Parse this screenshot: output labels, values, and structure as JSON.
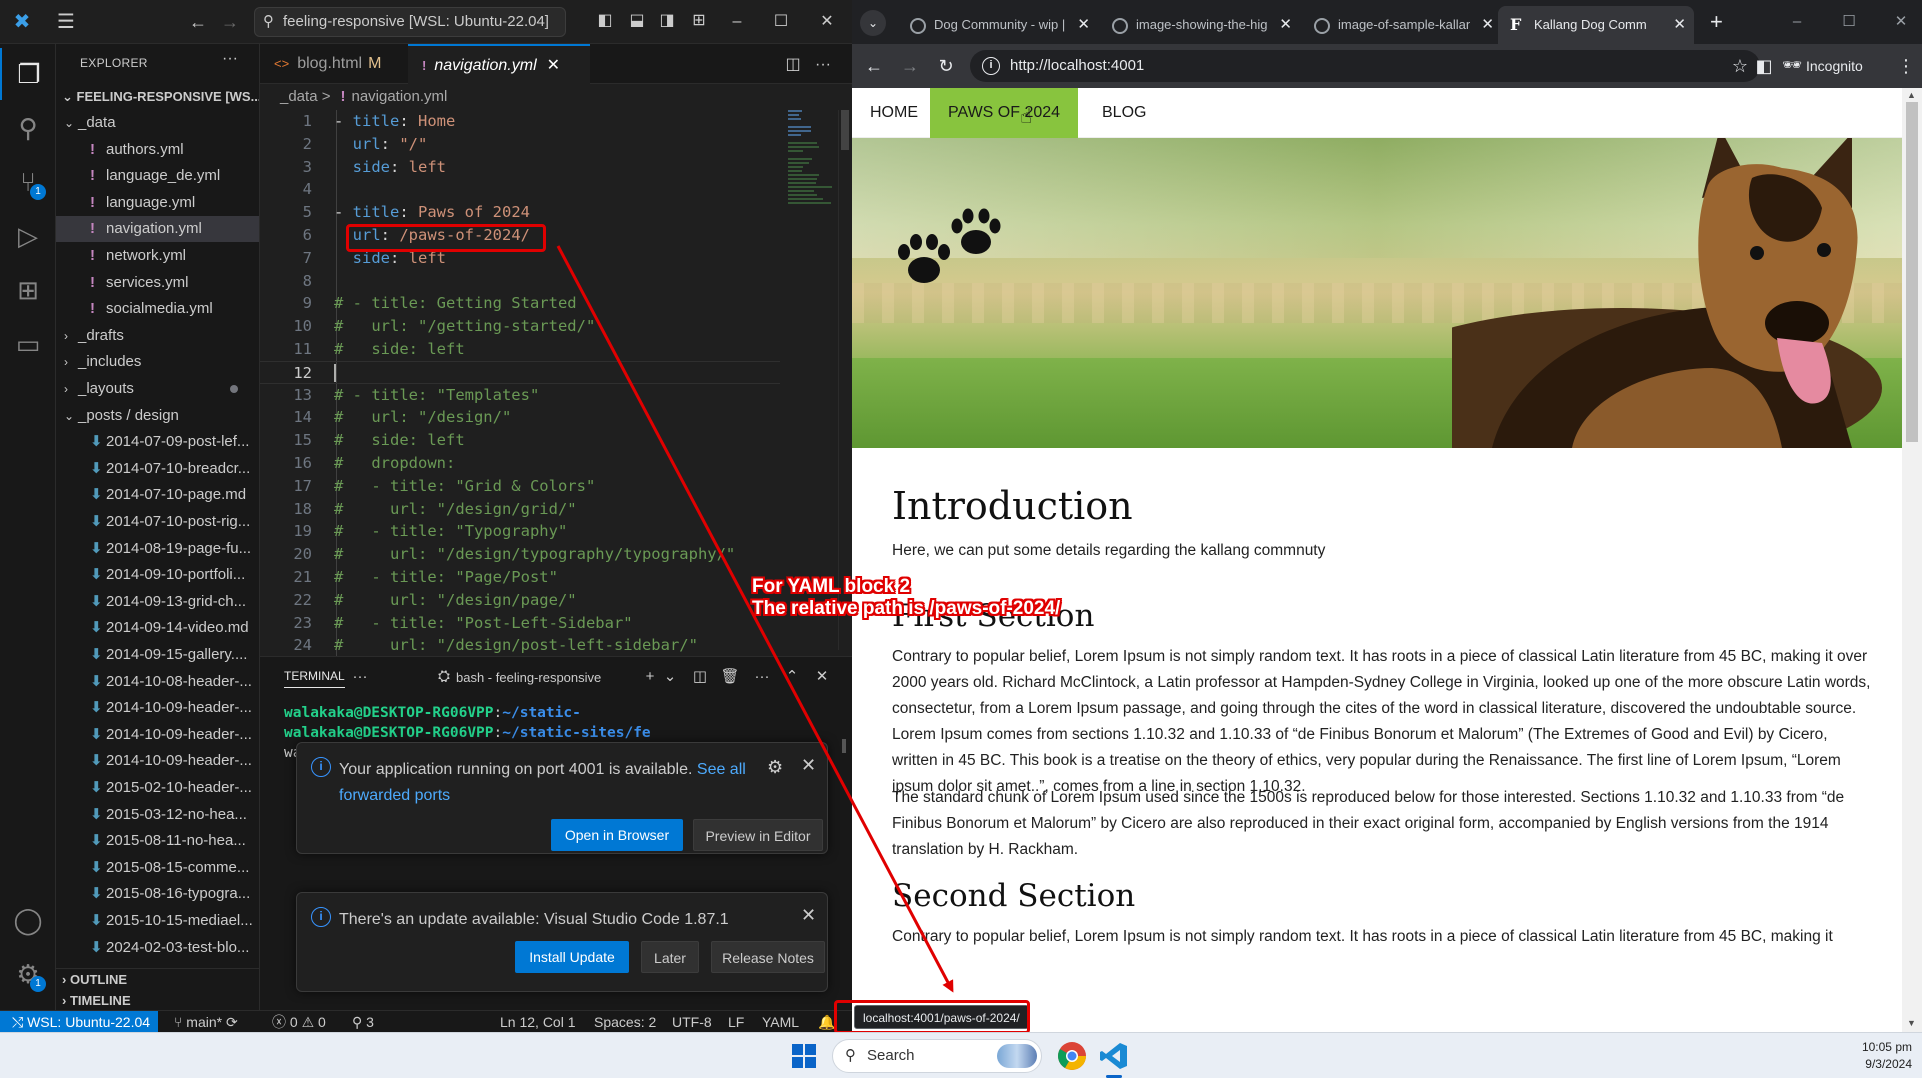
{
  "vscode": {
    "title": "feeling-responsive [WSL: Ubuntu-22.04]",
    "explorer": {
      "header": "EXPLORER",
      "root": "FEELING-RESPONSIVE [WS...",
      "items": [
        {
          "label": "_data",
          "kind": "folder-open",
          "indent": 1
        },
        {
          "label": "authors.yml",
          "kind": "yml",
          "indent": 2
        },
        {
          "label": "language_de.yml",
          "kind": "yml",
          "indent": 2
        },
        {
          "label": "language.yml",
          "kind": "yml",
          "indent": 2
        },
        {
          "label": "navigation.yml",
          "kind": "yml",
          "indent": 2,
          "selected": true
        },
        {
          "label": "network.yml",
          "kind": "yml",
          "indent": 2
        },
        {
          "label": "services.yml",
          "kind": "yml",
          "indent": 2
        },
        {
          "label": "socialmedia.yml",
          "kind": "yml",
          "indent": 2
        },
        {
          "label": "_drafts",
          "kind": "folder",
          "indent": 1
        },
        {
          "label": "_includes",
          "kind": "folder",
          "indent": 1
        },
        {
          "label": "_layouts",
          "kind": "folder",
          "indent": 1,
          "dot": true
        },
        {
          "label": "_posts / design",
          "kind": "folder-open",
          "indent": 1
        },
        {
          "label": "2014-07-09-post-lef...",
          "kind": "md",
          "indent": 2
        },
        {
          "label": "2014-07-10-breadcr...",
          "kind": "md",
          "indent": 2
        },
        {
          "label": "2014-07-10-page.md",
          "kind": "md",
          "indent": 2
        },
        {
          "label": "2014-07-10-post-rig...",
          "kind": "md",
          "indent": 2
        },
        {
          "label": "2014-08-19-page-fu...",
          "kind": "md",
          "indent": 2
        },
        {
          "label": "2014-09-10-portfoli...",
          "kind": "md",
          "indent": 2
        },
        {
          "label": "2014-09-13-grid-ch...",
          "kind": "md",
          "indent": 2
        },
        {
          "label": "2014-09-14-video.md",
          "kind": "md",
          "indent": 2
        },
        {
          "label": "2014-09-15-gallery....",
          "kind": "md",
          "indent": 2
        },
        {
          "label": "2014-10-08-header-...",
          "kind": "md",
          "indent": 2
        },
        {
          "label": "2014-10-09-header-...",
          "kind": "md",
          "indent": 2
        },
        {
          "label": "2014-10-09-header-...",
          "kind": "md",
          "indent": 2
        },
        {
          "label": "2014-10-09-header-...",
          "kind": "md",
          "indent": 2
        },
        {
          "label": "2015-02-10-header-...",
          "kind": "md",
          "indent": 2
        },
        {
          "label": "2015-03-12-no-hea...",
          "kind": "md",
          "indent": 2
        },
        {
          "label": "2015-08-11-no-hea...",
          "kind": "md",
          "indent": 2
        },
        {
          "label": "2015-08-15-comme...",
          "kind": "md",
          "indent": 2
        },
        {
          "label": "2015-08-16-typogra...",
          "kind": "md",
          "indent": 2
        },
        {
          "label": "2015-10-15-mediael...",
          "kind": "md",
          "indent": 2
        },
        {
          "label": "2024-02-03-test-blo...",
          "kind": "md",
          "indent": 2
        }
      ],
      "outline": "OUTLINE",
      "timeline": "TIMELINE"
    },
    "tabs": [
      {
        "label": "blog.html",
        "badge": "M",
        "icon": "<>"
      },
      {
        "label": "navigation.yml",
        "icon": "!",
        "active": true
      }
    ],
    "breadcrumb": {
      "folder": "_data",
      "sep": ">",
      "icon": "!",
      "file": "navigation.yml"
    },
    "code_lines": [
      {
        "n": "1",
        "t": [
          [
            "p",
            "- "
          ],
          [
            "k",
            "title"
          ],
          [
            "p",
            ": "
          ],
          [
            "s",
            "Home"
          ]
        ]
      },
      {
        "n": "2",
        "t": [
          [
            "p",
            "  "
          ],
          [
            "k",
            "url"
          ],
          [
            "p",
            ": "
          ],
          [
            "s",
            "\"/\""
          ]
        ]
      },
      {
        "n": "3",
        "t": [
          [
            "p",
            "  "
          ],
          [
            "k",
            "side"
          ],
          [
            "p",
            ": "
          ],
          [
            "s",
            "left"
          ]
        ]
      },
      {
        "n": "4",
        "t": []
      },
      {
        "n": "5",
        "t": [
          [
            "p",
            "- "
          ],
          [
            "k",
            "title"
          ],
          [
            "p",
            ": "
          ],
          [
            "s",
            "Paws of 2024"
          ]
        ]
      },
      {
        "n": "6",
        "t": [
          [
            "p",
            "  "
          ],
          [
            "k",
            "url"
          ],
          [
            "p",
            ": "
          ],
          [
            "s",
            "/paws-of-2024/"
          ]
        ]
      },
      {
        "n": "7",
        "t": [
          [
            "p",
            "  "
          ],
          [
            "k",
            "side"
          ],
          [
            "p",
            ": "
          ],
          [
            "s",
            "left"
          ]
        ]
      },
      {
        "n": "8",
        "t": []
      },
      {
        "n": "9",
        "t": [
          [
            "c",
            "# - title: Getting Started"
          ]
        ]
      },
      {
        "n": "10",
        "t": [
          [
            "c",
            "#   url: \"/getting-started/\""
          ]
        ]
      },
      {
        "n": "11",
        "t": [
          [
            "c",
            "#   side: left"
          ]
        ]
      },
      {
        "n": "12",
        "t": [],
        "current": true
      },
      {
        "n": "13",
        "t": [
          [
            "c",
            "# - title: \"Templates\""
          ]
        ]
      },
      {
        "n": "14",
        "t": [
          [
            "c",
            "#   url: \"/design/\""
          ]
        ]
      },
      {
        "n": "15",
        "t": [
          [
            "c",
            "#   side: left"
          ]
        ]
      },
      {
        "n": "16",
        "t": [
          [
            "c",
            "#   dropdown:"
          ]
        ]
      },
      {
        "n": "17",
        "t": [
          [
            "c",
            "#   - title: \"Grid & Colors\""
          ]
        ]
      },
      {
        "n": "18",
        "t": [
          [
            "c",
            "#     url: \"/design/grid/\""
          ]
        ]
      },
      {
        "n": "19",
        "t": [
          [
            "c",
            "#   - title: \"Typography\""
          ]
        ]
      },
      {
        "n": "20",
        "t": [
          [
            "c",
            "#     url: \"/design/typography/typography/\""
          ]
        ]
      },
      {
        "n": "21",
        "t": [
          [
            "c",
            "#   - title: \"Page/Post\""
          ]
        ]
      },
      {
        "n": "22",
        "t": [
          [
            "c",
            "#     url: \"/design/page/\""
          ]
        ]
      },
      {
        "n": "23",
        "t": [
          [
            "c",
            "#   - title: \"Post-Left-Sidebar\""
          ]
        ]
      },
      {
        "n": "24",
        "t": [
          [
            "c",
            "#     url: \"/design/post-left-sidebar/\""
          ]
        ]
      }
    ],
    "terminal": {
      "tab": "TERMINAL",
      "shell": "bash - feeling-responsive",
      "lines": [
        {
          "user": "walakaka@DESKTOP-RG06VPP",
          "sep": ":",
          "dir": "~/static-"
        },
        {
          "user": "walakaka@DESKTOP-RG06VPP",
          "sep": ":",
          "dir": "~/static-sites/fe"
        },
        {
          "user": "wa",
          "sep": "",
          "dir": ""
        }
      ]
    },
    "notifications": [
      {
        "message": "Your application running on port 4001 is available.",
        "link": "See all forwarded ports",
        "buttons": [
          "Open in Browser",
          "Preview in Editor"
        ]
      },
      {
        "message": "There's an update available: Visual Studio Code 1.87.1",
        "buttons": [
          "Install Update",
          "Later",
          "Release Notes"
        ]
      }
    ],
    "status": {
      "remote": "WSL: Ubuntu-22.04",
      "branch": "main*",
      "errors": "0",
      "warnings": "0",
      "ports": "3",
      "position": "Ln 12, Col 1",
      "spaces": "Spaces: 2",
      "encoding": "UTF-8",
      "eol": "LF",
      "language": "YAML"
    }
  },
  "chrome": {
    "tabs": [
      {
        "label": "Dog Community - wip | S"
      },
      {
        "label": "image-showing-the-high"
      },
      {
        "label": "image-of-sample-kallan"
      },
      {
        "label": "Kallang Dog Comm",
        "active": true
      }
    ],
    "url": "http://localhost:4001",
    "profile": "Incognito",
    "status_url": "localhost:4001/paws-of-2024/",
    "site": {
      "nav": [
        "HOME",
        "PAWS OF 2024",
        "BLOG"
      ],
      "intro_title": "Introduction",
      "intro_text": "Here, we can put some details regarding the kallang commnuty",
      "section1_title": "First Section",
      "section1_p1": "Contrary to popular belief, Lorem Ipsum is not simply random text. It has roots in a piece of classical Latin literature from 45 BC, making it over 2000 years old. Richard McClintock, a Latin professor at Hampden-Sydney College in Virginia, looked up one of the more obscure Latin words, consectetur, from a Lorem Ipsum passage, and going through the cites of the word in classical literature, discovered the undoubtable source. Lorem Ipsum comes from sections 1.10.32 and 1.10.33 of “de Finibus Bonorum et Malorum” (The Extremes of Good and Evil) by Cicero, written in 45 BC. This book is a treatise on the theory of ethics, very popular during the Renaissance. The first line of Lorem Ipsum, “Lorem ipsum dolor sit amet..”, comes from a line in section 1.10.32.",
      "section1_p2": "The standard chunk of Lorem Ipsum used since the 1500s is reproduced below for those interested. Sections 1.10.32 and 1.10.33 from “de Finibus Bonorum et Malorum” by Cicero are also reproduced in their exact original form, accompanied by English versions from the 1914 translation by H. Rackham.",
      "section2_title": "Second Section",
      "section2_p1": "Contrary to popular belief, Lorem Ipsum is not simply random text. It has roots in a piece of classical Latin literature from 45 BC, making it"
    }
  },
  "annotation": {
    "line1": "For YAML block 2",
    "line2": "The relative path is /paws-of-2024/"
  },
  "taskbar": {
    "search": "Search",
    "time": "10:05 pm",
    "date": "9/3/2024"
  },
  "colors": {
    "vscode_accent": "#0078d4",
    "nav_highlight": "#88c43e",
    "annotation_red": "#e00000"
  }
}
